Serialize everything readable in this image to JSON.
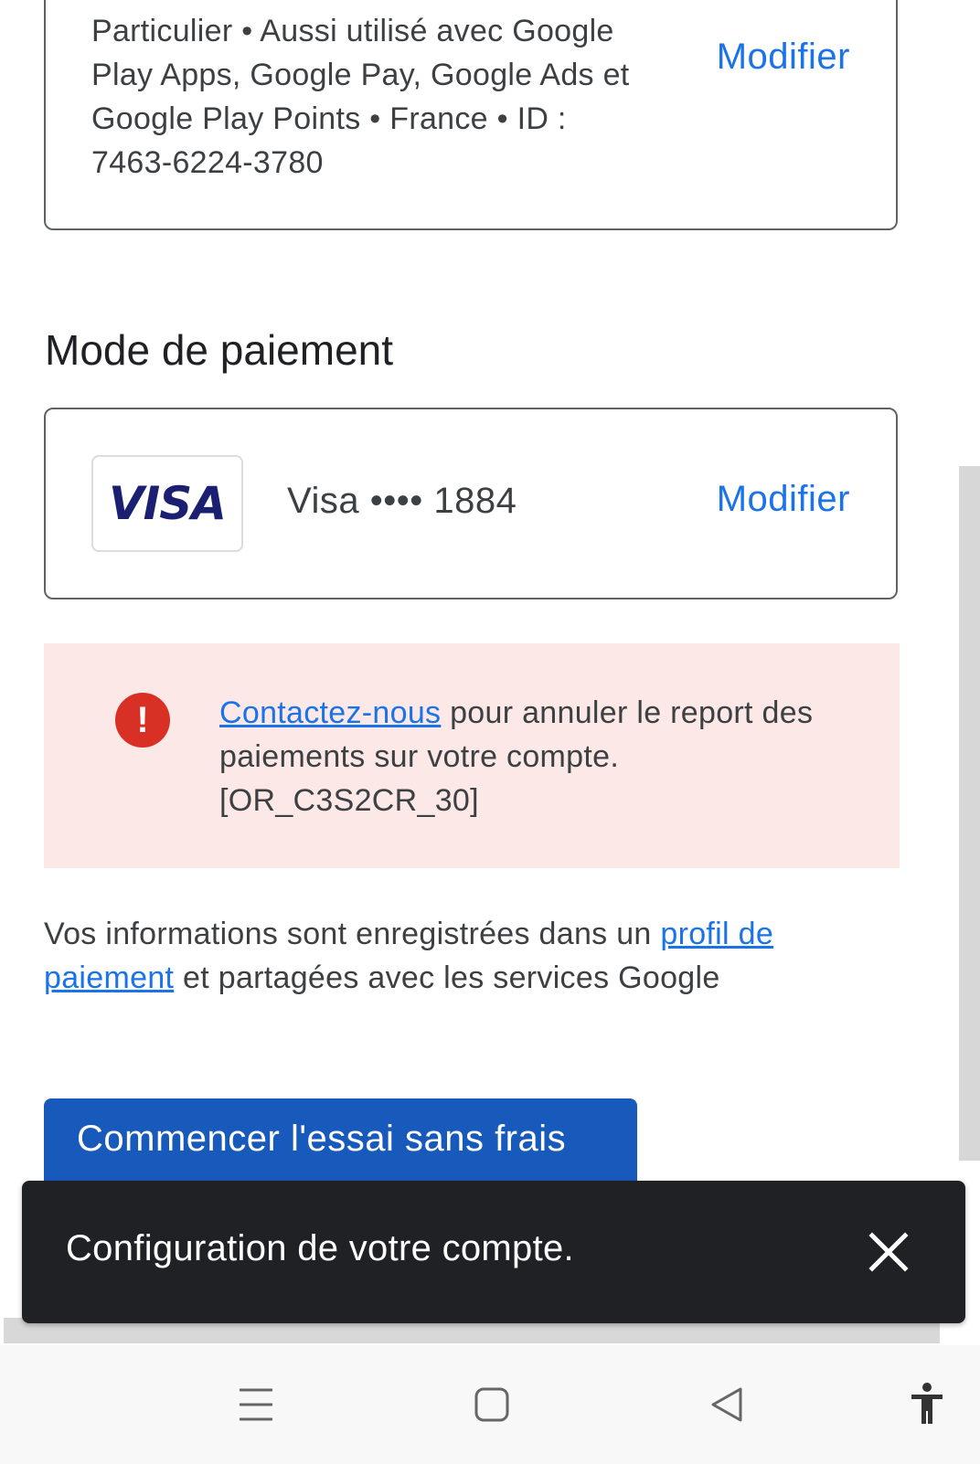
{
  "account": {
    "details": "Particulier • Aussi utilisé avec Google Play Apps, Google Pay, Google Ads et Google Play Points • France • ID : 7463-6224-3780",
    "modify_label": "Modifier"
  },
  "payment": {
    "section_title": "Mode de paiement",
    "card_brand": "VISA",
    "card_label": "Visa •••• 1884",
    "modify_label": "Modifier"
  },
  "error": {
    "link_text": "Contactez-nous",
    "message": " pour annuler le report des paiements sur votre compte. [OR_C3S2CR_30]",
    "icon": "error-icon"
  },
  "info": {
    "prefix": "Vos informations sont enregistrées dans un ",
    "link_text": "profil de paiement",
    "suffix": " et partagées avec les services Google"
  },
  "cta": {
    "label": "Commencer l'essai sans frais"
  },
  "snackbar": {
    "message": "Configuration de votre compte.",
    "close_icon": "close-icon"
  },
  "navbar": {
    "icons": [
      "recent-apps-icon",
      "home-icon",
      "back-icon",
      "accessibility-icon"
    ]
  },
  "colors": {
    "accent": "#1a73e8",
    "button": "#185abc",
    "error": "#d93025",
    "error_bg": "#fce8e6",
    "snackbar_bg": "#202124",
    "visa": "#1a1f71"
  }
}
